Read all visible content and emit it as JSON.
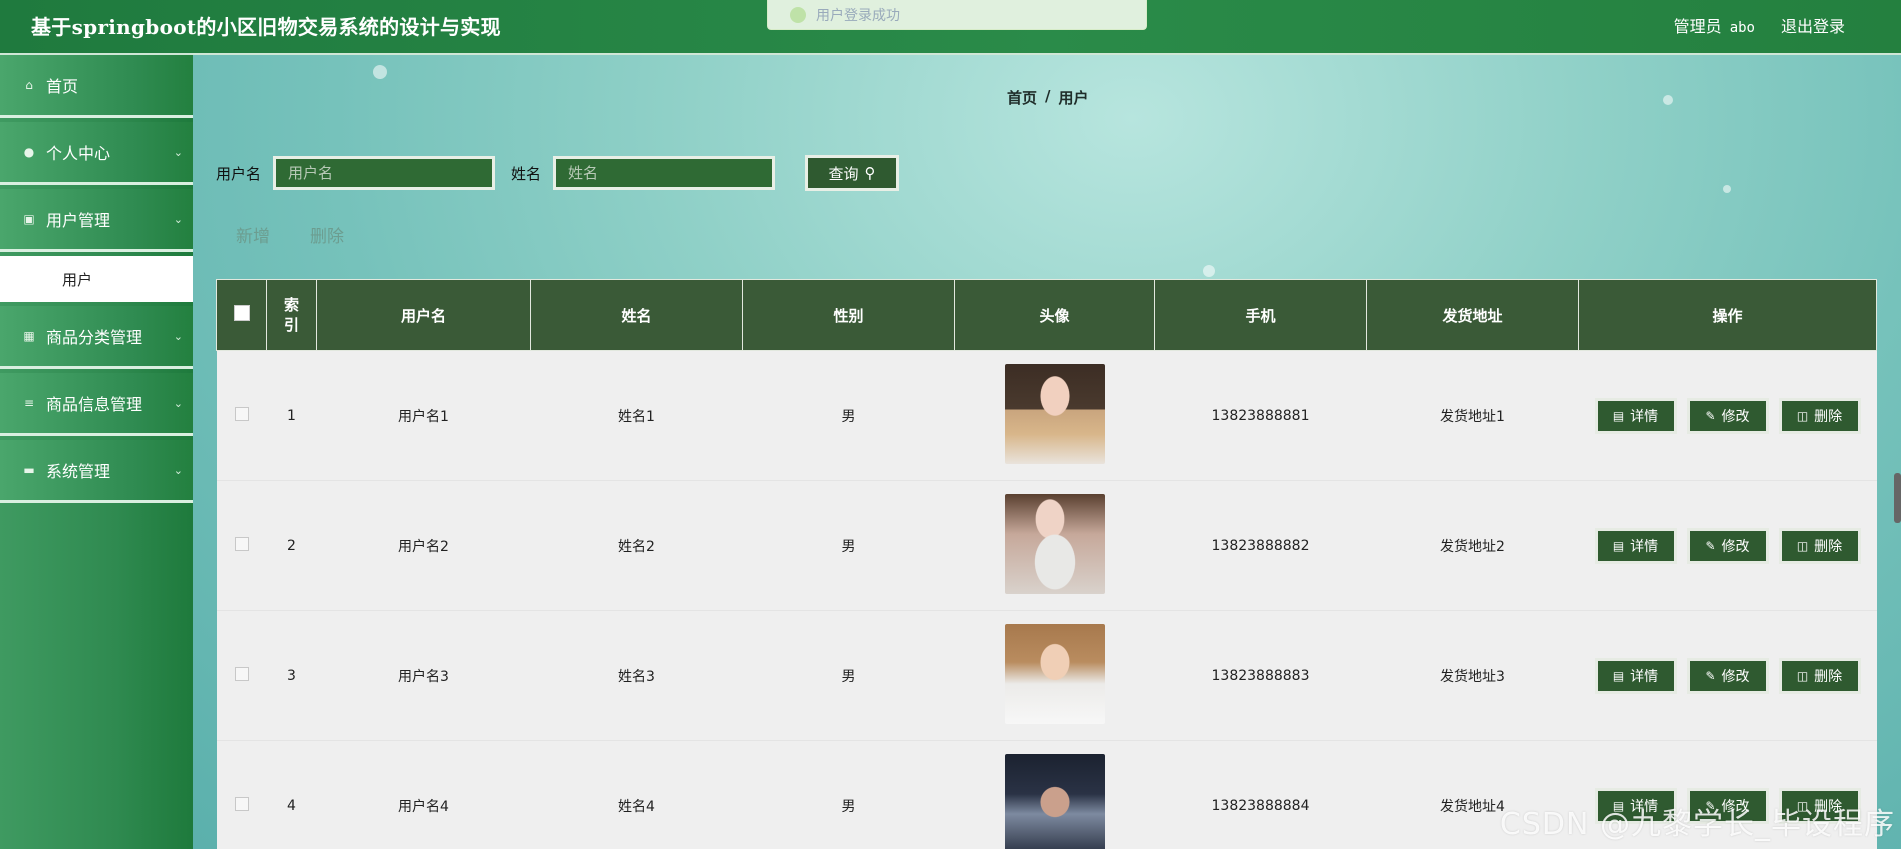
{
  "app": {
    "title": "基于springboot的小区旧物交易系统的设计与实现"
  },
  "toast": {
    "text": "用户登录成功"
  },
  "topbar": {
    "role": "管理员",
    "username": "abo",
    "logout_label": "退出登录"
  },
  "sidebar": {
    "items": [
      {
        "label": "首页",
        "icon": "home-icon"
      },
      {
        "label": "个人中心",
        "icon": "user-icon"
      },
      {
        "label": "用户管理",
        "icon": "users-icon"
      },
      {
        "label": "商品分类管理",
        "icon": "grid-icon"
      },
      {
        "label": "商品信息管理",
        "icon": "list-icon"
      },
      {
        "label": "系统管理",
        "icon": "monitor-icon"
      }
    ],
    "sub_item": {
      "label": "用户"
    }
  },
  "breadcrumb": {
    "home": "首页",
    "sep": "/",
    "current": "用户"
  },
  "search": {
    "username_label": "用户名",
    "username_placeholder": "用户名",
    "name_label": "姓名",
    "name_placeholder": "姓名",
    "query_label": "查询"
  },
  "actions": {
    "add": "新增",
    "delete": "删除"
  },
  "table": {
    "headers": [
      "",
      "索引",
      "用户名",
      "姓名",
      "性别",
      "头像",
      "手机",
      "发货地址",
      "操作"
    ],
    "op_labels": {
      "detail": "详情",
      "edit": "修改",
      "delete": "删除"
    },
    "rows": [
      {
        "index": "1",
        "username": "用户名1",
        "name": "姓名1",
        "gender": "男",
        "phone": "13823888881",
        "address": "发货地址1"
      },
      {
        "index": "2",
        "username": "用户名2",
        "name": "姓名2",
        "gender": "男",
        "phone": "13823888882",
        "address": "发货地址2"
      },
      {
        "index": "3",
        "username": "用户名3",
        "name": "姓名3",
        "gender": "男",
        "phone": "13823888883",
        "address": "发货地址3"
      },
      {
        "index": "4",
        "username": "用户名4",
        "name": "姓名4",
        "gender": "男",
        "phone": "13823888884",
        "address": "发货地址4"
      }
    ]
  },
  "watermark": {
    "text": "CSDN @九黎学长_毕设程序"
  },
  "colors": {
    "header_green": "#2a8b49",
    "button_dark": "#2f5a30",
    "table_head": "#3a5a37"
  }
}
